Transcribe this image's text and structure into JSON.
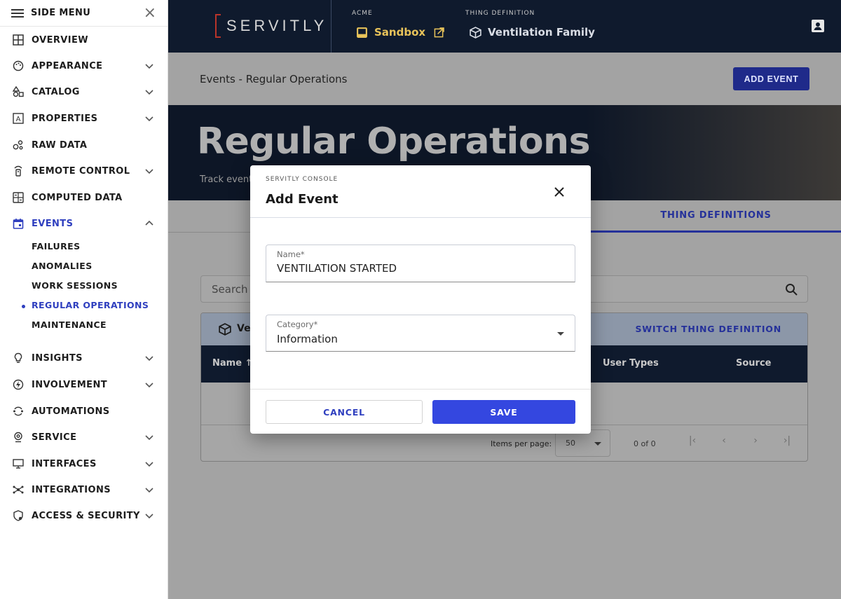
{
  "sidebar": {
    "header": "SIDE MENU",
    "items": [
      {
        "label": "OVERVIEW"
      },
      {
        "label": "APPEARANCE"
      },
      {
        "label": "CATALOG"
      },
      {
        "label": "PROPERTIES"
      },
      {
        "label": "RAW DATA"
      },
      {
        "label": "REMOTE CONTROL"
      },
      {
        "label": "COMPUTED DATA"
      },
      {
        "label": "EVENTS"
      },
      {
        "label": "INSIGHTS"
      },
      {
        "label": "INVOLVEMENT"
      },
      {
        "label": "AUTOMATIONS"
      },
      {
        "label": "SERVICE"
      },
      {
        "label": "INTERFACES"
      },
      {
        "label": "INTEGRATIONS"
      },
      {
        "label": "ACCESS & SECURITY"
      }
    ],
    "events_sub": [
      {
        "label": "FAILURES"
      },
      {
        "label": "ANOMALIES"
      },
      {
        "label": "WORK SESSIONS"
      },
      {
        "label": "REGULAR OPERATIONS"
      },
      {
        "label": "MAINTENANCE"
      }
    ]
  },
  "topbar": {
    "logo": "SERVITLY",
    "tenant_label": "ACME",
    "tenant_value": "Sandbox",
    "thing_label": "THING DEFINITION",
    "thing_value": "Ventilation Family"
  },
  "page": {
    "breadcrumb": "Events - Regular Operations",
    "add_button": "ADD EVENT",
    "hero_title": "Regular Operations",
    "hero_sub": "Track event",
    "tab_active": "THING DEFINITIONS",
    "search_placeholder": "Search",
    "panel_title": "Ve",
    "switch_label": "SWITCH THING DEFINITION",
    "columns": {
      "name": "Name",
      "user_types": "User Types",
      "source": "Source"
    },
    "items_per_page_label": "Items per page:",
    "items_per_page_value": "50",
    "range": "0 of 0"
  },
  "modal": {
    "eyebrow": "SERVITLY CONSOLE",
    "title": "Add Event",
    "name_label": "Name*",
    "name_value": "VENTILATION STARTED",
    "category_label": "Category*",
    "category_value": "Information",
    "cancel_label": "CANCEL",
    "save_label": "SAVE"
  },
  "colors": {
    "accent": "#3447e0",
    "navy": "#0f1a2d",
    "gold": "#e8c35a",
    "active_nav": "#2f3fbf"
  }
}
